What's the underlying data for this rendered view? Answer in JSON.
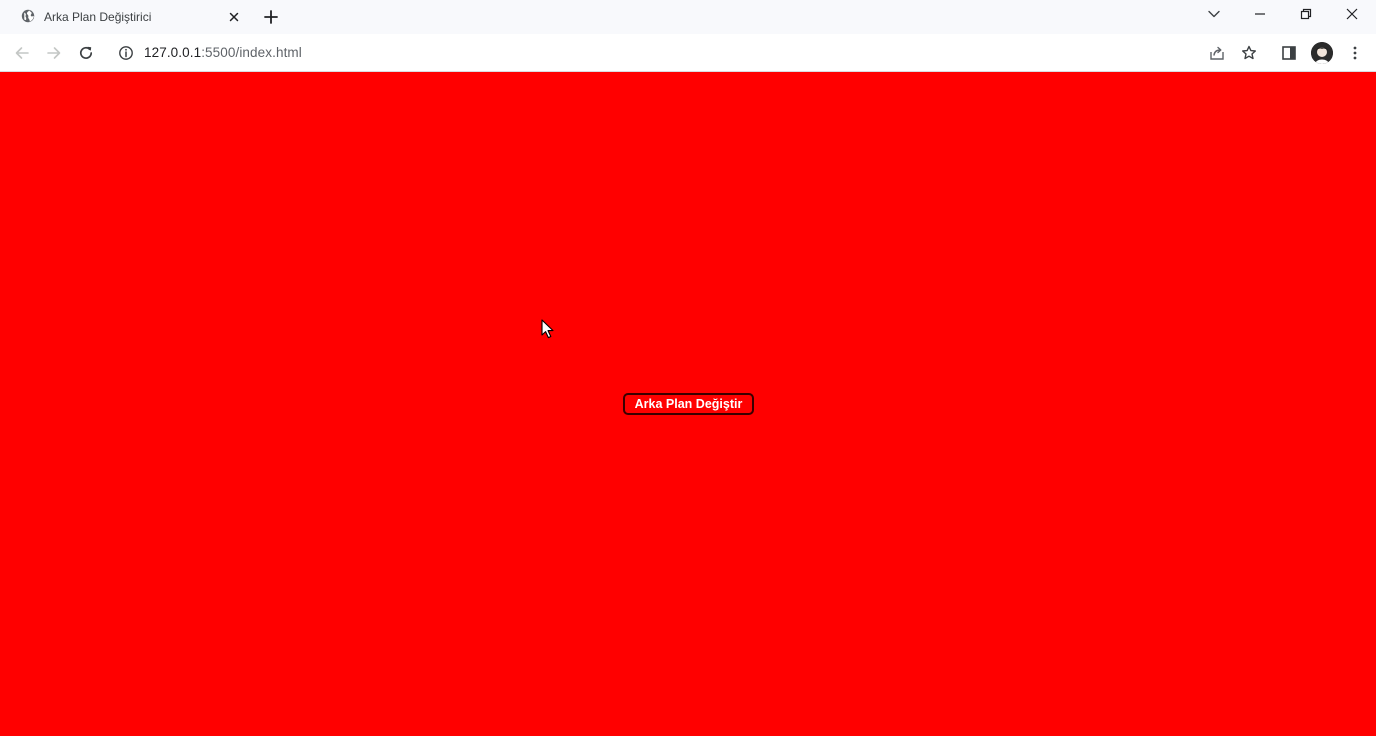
{
  "tab": {
    "title": "Arka Plan Değiştirici",
    "favicon": "globe-icon"
  },
  "address_bar": {
    "host": "127.0.0.1",
    "rest": ":5500/index.html"
  },
  "page": {
    "background_color": "#ff0000",
    "button_label": "Arka Plan Değiştir"
  },
  "icons": {
    "back": "arrow-left-icon",
    "forward": "arrow-right-icon",
    "reload": "reload-icon",
    "site_info": "info-icon",
    "share": "share-icon",
    "bookmark": "star-icon",
    "side_panel": "side-panel-icon",
    "menu": "more-vertical-icon"
  }
}
